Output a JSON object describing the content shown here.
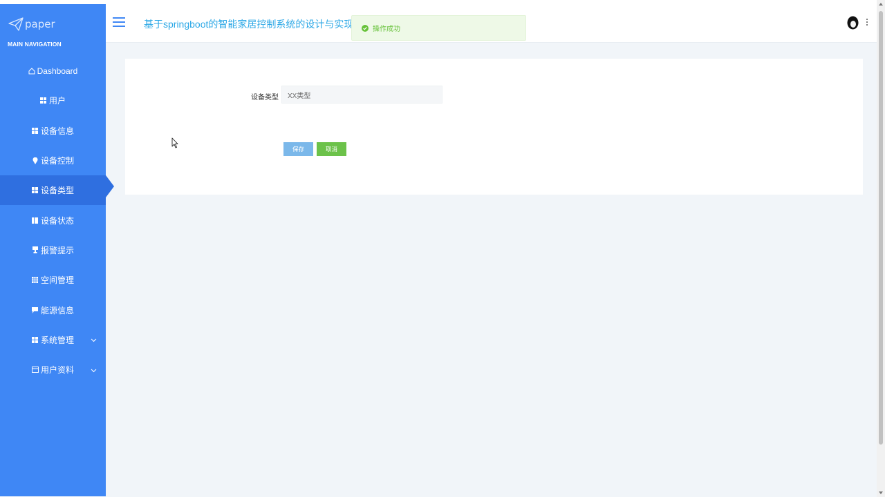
{
  "brand": {
    "name": "paper",
    "icon": "paper-plane-icon"
  },
  "nav_caption": "MAIN NAVIGATION",
  "sidebar": {
    "items": [
      {
        "label": "Dashboard",
        "icon": "home-icon",
        "active": false,
        "expandable": false
      },
      {
        "label": "用户",
        "icon": "grid-icon",
        "active": false,
        "expandable": false
      },
      {
        "label": "设备信息",
        "icon": "grid-icon",
        "active": false,
        "expandable": false
      },
      {
        "label": "设备控制",
        "icon": "location-pin-icon",
        "active": false,
        "expandable": false
      },
      {
        "label": "设备类型",
        "icon": "grid-icon",
        "active": true,
        "expandable": false
      },
      {
        "label": "设备状态",
        "icon": "book-icon",
        "active": false,
        "expandable": false
      },
      {
        "label": "报警提示",
        "icon": "trophy-icon",
        "active": false,
        "expandable": false
      },
      {
        "label": "空间管理",
        "icon": "table-icon",
        "active": false,
        "expandable": false
      },
      {
        "label": "能源信息",
        "icon": "comment-icon",
        "active": false,
        "expandable": false
      },
      {
        "label": "系统管理",
        "icon": "grid-icon",
        "active": false,
        "expandable": true
      },
      {
        "label": "用户资料",
        "icon": "calendar-icon",
        "active": false,
        "expandable": true
      }
    ]
  },
  "header": {
    "title": "基于springboot的智能家居控制系统的设计与实现",
    "toast": "操作成功"
  },
  "form": {
    "field_label": "设备类型",
    "field_value": "XX类型",
    "save_label": "保存",
    "cancel_label": "取消"
  },
  "colors": {
    "sidebar": "#3f87f5",
    "sidebar_active": "#2f6fe0",
    "title": "#2aa7e6",
    "toast_text": "#67c23a",
    "save_button": "#7bb8ea",
    "cancel_button": "#6cc24a"
  }
}
